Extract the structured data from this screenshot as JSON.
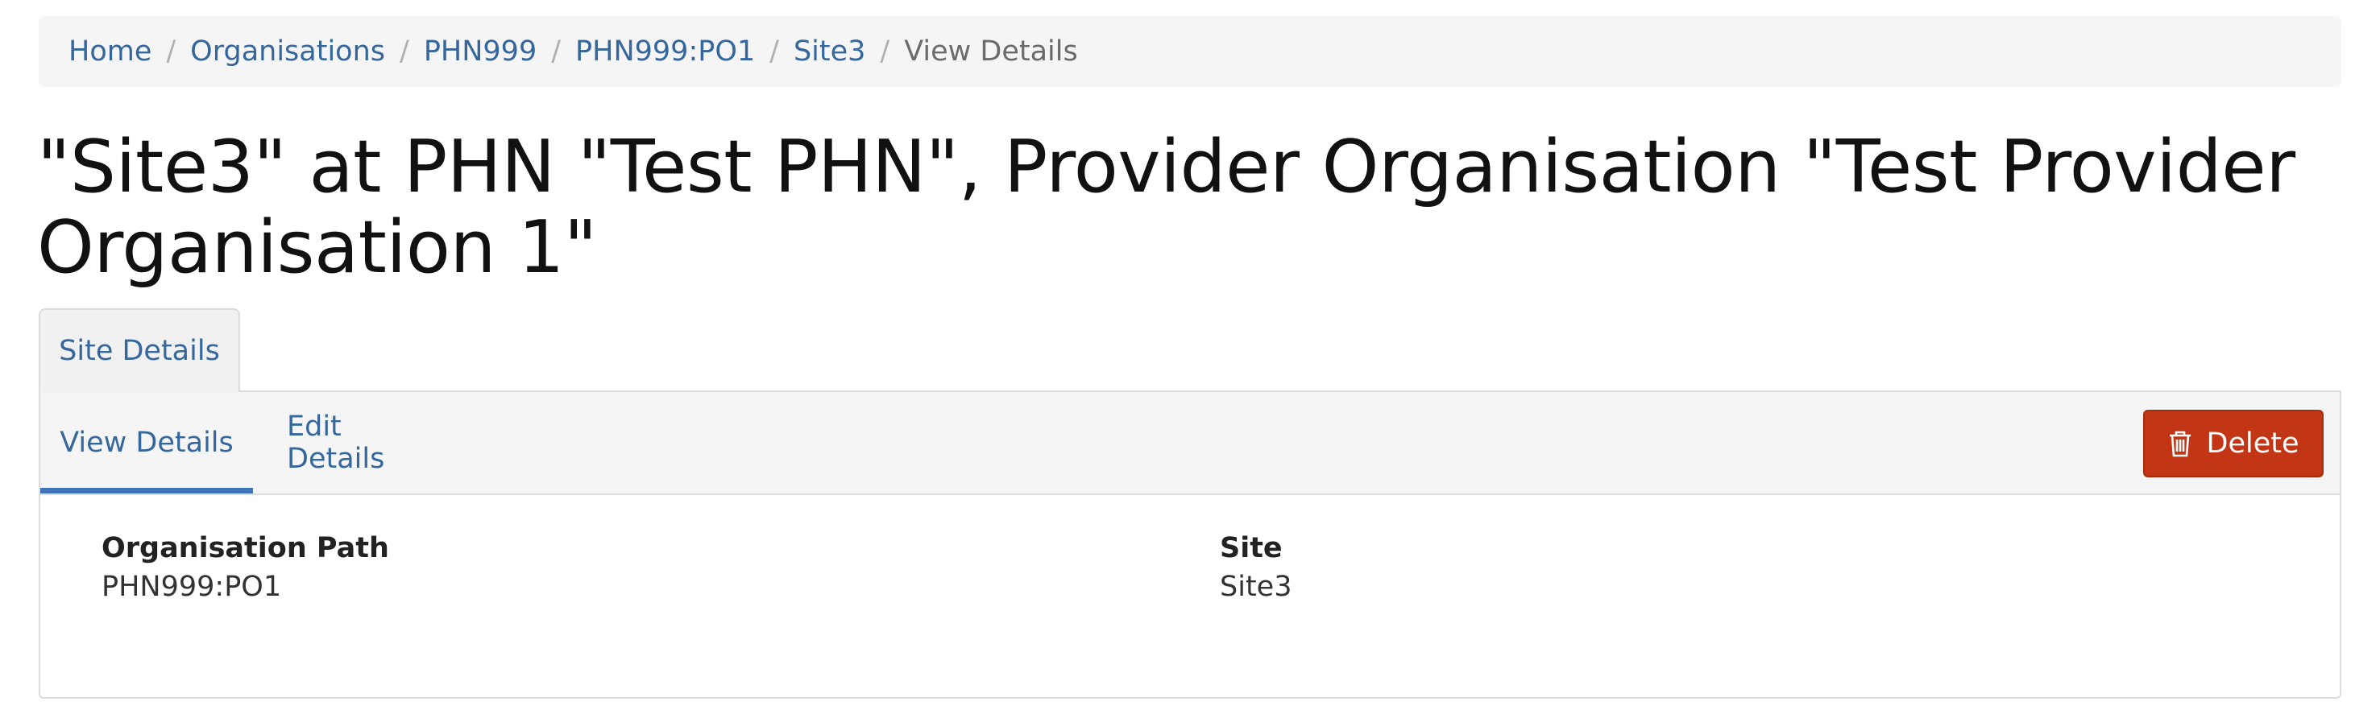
{
  "breadcrumb": {
    "items": [
      {
        "label": "Home"
      },
      {
        "label": "Organisations"
      },
      {
        "label": "PHN999"
      },
      {
        "label": "PHN999:PO1"
      },
      {
        "label": "Site3"
      }
    ],
    "current": "View Details",
    "separator": "/"
  },
  "page": {
    "title": "\"Site3\" at PHN \"Test PHN\", Provider Organisation \"Test Provider Organisation 1\""
  },
  "tabs": {
    "top": "Site Details",
    "sub": [
      {
        "label": "View Details",
        "active": true
      },
      {
        "label": "Edit Details",
        "active": false
      }
    ]
  },
  "actions": {
    "delete_label": "Delete",
    "delete_icon": "trash-icon"
  },
  "details": {
    "organisation_path_label": "Organisation Path",
    "organisation_path_value": "PHN999:PO1",
    "site_label": "Site",
    "site_value": "Site3"
  },
  "colors": {
    "link": "#35679c",
    "active_tab_underline": "#3d73b9",
    "delete_button": "#c23515",
    "breadcrumb_bg": "#f5f5f5"
  }
}
